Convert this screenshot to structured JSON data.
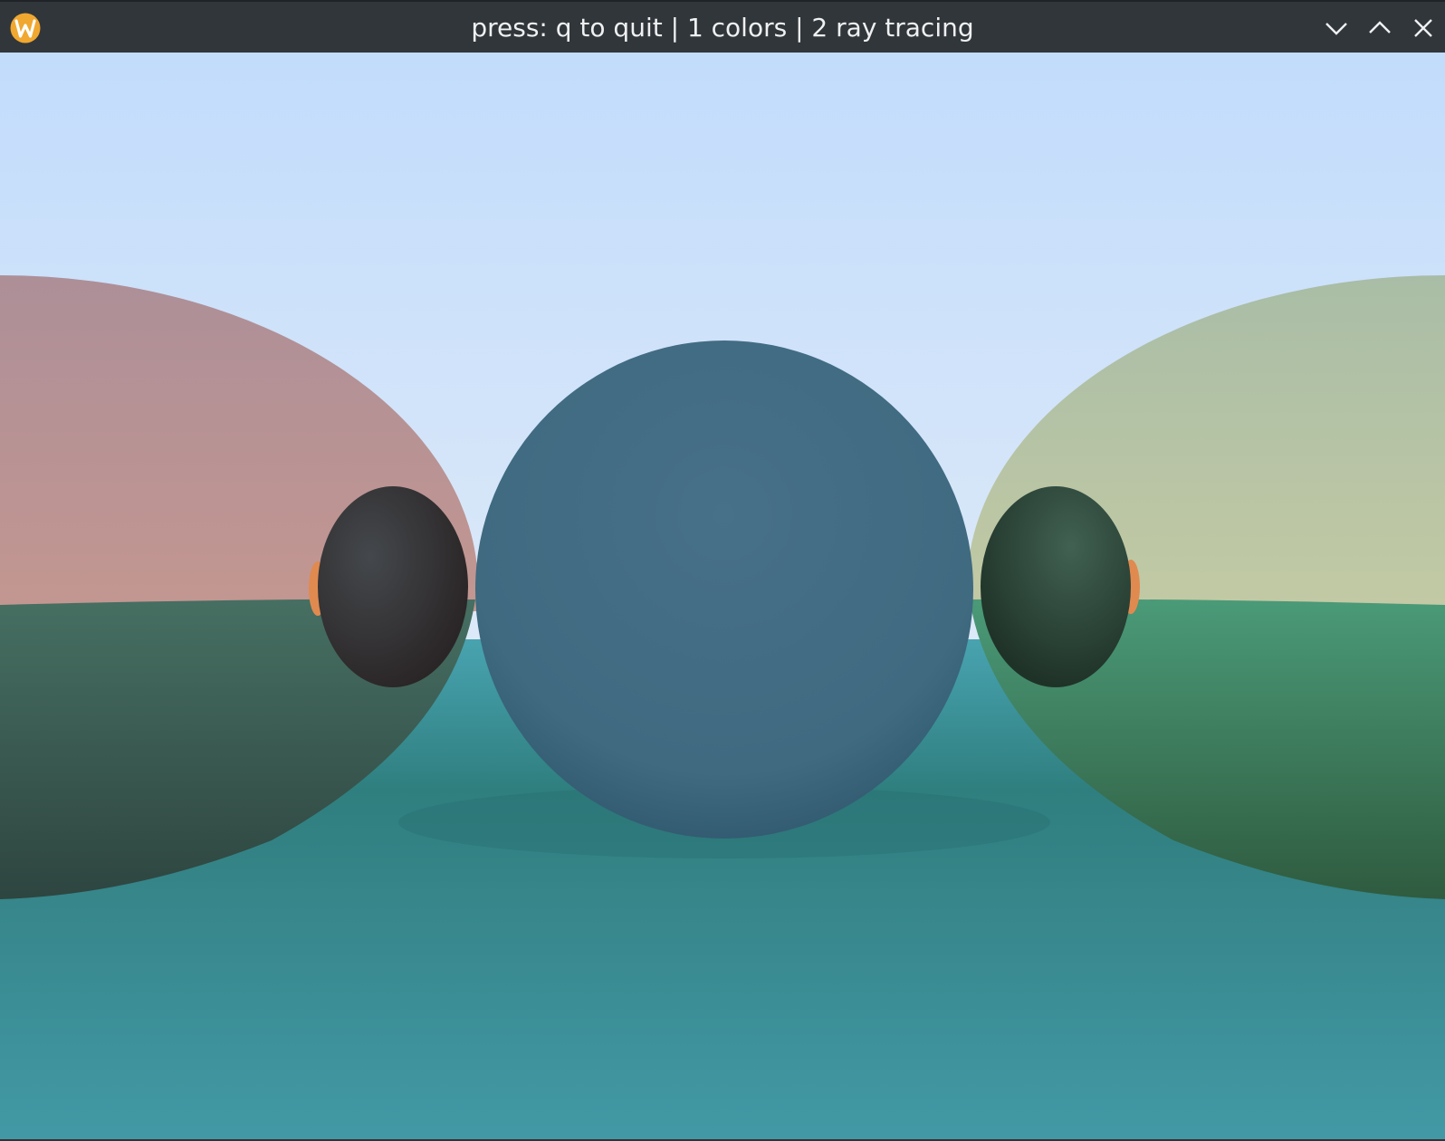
{
  "window": {
    "title": "press: q to quit | 1 colors | 2 ray tracing"
  },
  "icons": {
    "app": "wayland-logo-icon",
    "minimize": "chevron-down-icon",
    "maximize": "chevron-up-icon",
    "close": "close-icon"
  },
  "colors": {
    "titlebar": "#31363b",
    "title_text": "#eff0f1",
    "sky_top": "#c2dcfc",
    "sky_horizon": "#dce9f8",
    "ground": "#3f9aa5",
    "center_sphere": "#456f88",
    "left_sphere_top": "#d49a8a",
    "left_sphere_bottom": "#3f6e5e",
    "right_sphere_top": "#d6d3a2",
    "right_sphere_bottom": "#3f9a72",
    "small_sphere_left": "#3a3d40",
    "small_sphere_right": "#35574a",
    "app_icon": "#f0a830"
  }
}
